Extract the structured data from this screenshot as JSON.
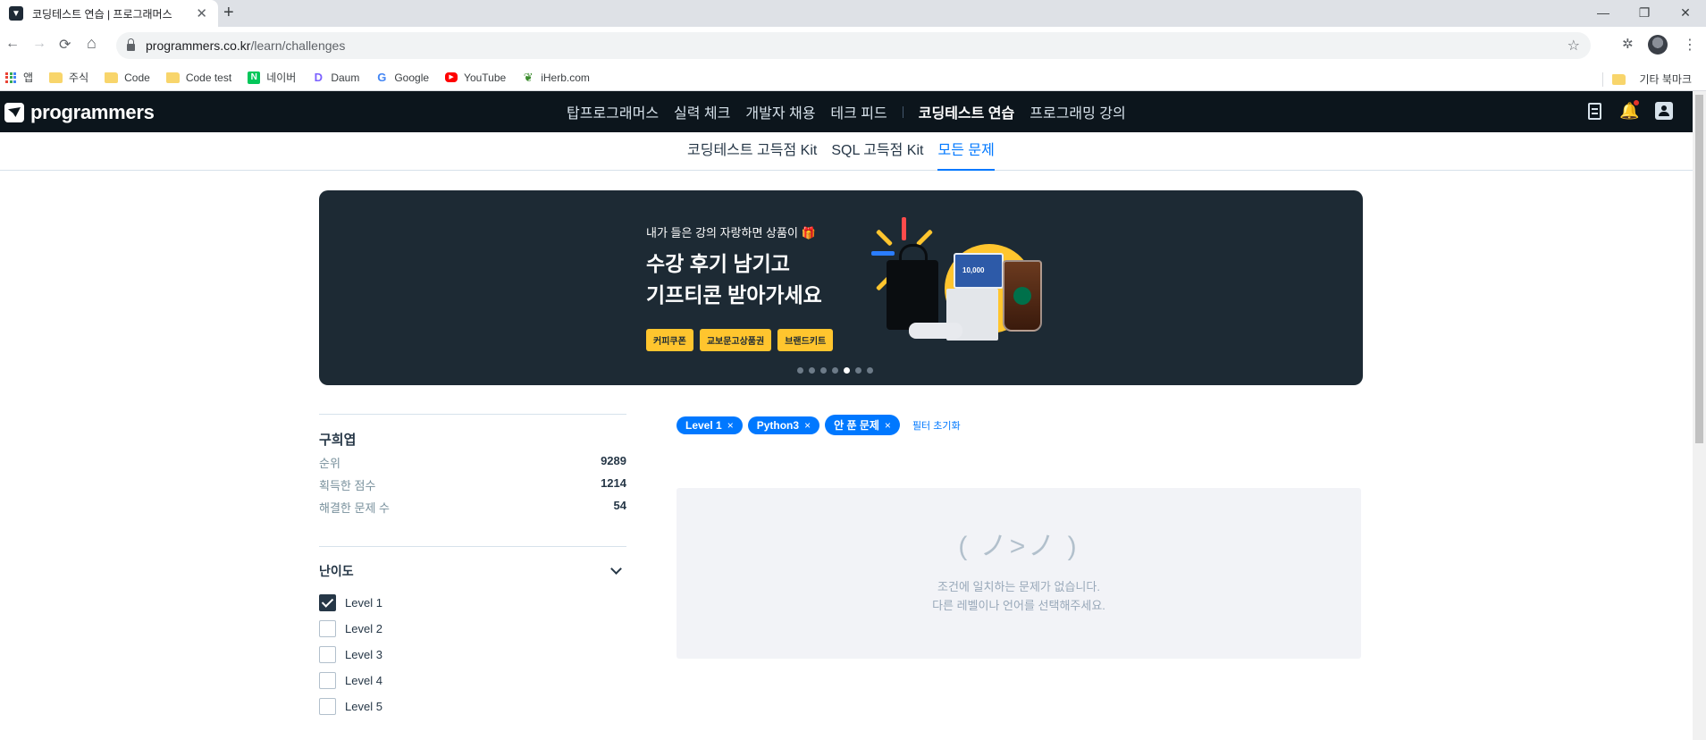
{
  "browser": {
    "tab_title": "코딩테스트 연습 | 프로그래머스",
    "tab_close": "✕",
    "new_tab": "+",
    "url_host": "programmers.co.kr",
    "url_path": "/learn/challenges",
    "win_minimize": "—",
    "win_restore": "❐",
    "win_close": "✕",
    "back": "←",
    "forward": "→",
    "reload": "⟳",
    "home": "⌂",
    "star": "☆",
    "extensions": "✲",
    "menu": "⋮",
    "bookmarks": [
      {
        "label": "앱",
        "icon": "apps-grid-icon"
      },
      {
        "label": "주식",
        "icon": "folder-icon"
      },
      {
        "label": "Code",
        "icon": "folder-icon"
      },
      {
        "label": "Code test",
        "icon": "folder-icon"
      },
      {
        "label": "네이버",
        "icon": "naver-icon",
        "glyph": "N",
        "color": "#03c75a"
      },
      {
        "label": "Daum",
        "icon": "daum-icon",
        "glyph": "D",
        "color": "#7b61ff"
      },
      {
        "label": "Google",
        "icon": "google-icon",
        "glyph": "G",
        "color": "#4285f4"
      },
      {
        "label": "YouTube",
        "icon": "youtube-icon",
        "glyph": "▶",
        "color": "#ff0000"
      },
      {
        "label": "iHerb.com",
        "icon": "iherb-icon",
        "glyph": "❦",
        "color": "#3c8d2f"
      }
    ],
    "other_bookmarks": "기타 북마크"
  },
  "gnb": {
    "logo": "programmers",
    "menu": [
      {
        "label": "탑프로그래머스",
        "active": false
      },
      {
        "label": "실력 체크",
        "active": false
      },
      {
        "label": "개발자 채용",
        "active": false
      },
      {
        "label": "테크 피드",
        "active": false
      },
      {
        "label": "코딩테스트 연습",
        "active": true
      },
      {
        "label": "프로그래밍 강의",
        "active": false
      }
    ],
    "bell": "🔔"
  },
  "subnav": [
    {
      "label": "코딩테스트 고득점 Kit",
      "active": false
    },
    {
      "label": "SQL 고득점 Kit",
      "active": false
    },
    {
      "label": "모든 문제",
      "active": true
    }
  ],
  "banner": {
    "kicker": "내가 들은 강의 자랑하면 상품이 🎁",
    "title_line1": "수강 후기 남기고",
    "title_line2": "기프티콘 받아가세요",
    "tags": [
      "커피쿠폰",
      "교보문고상품권",
      "브랜드키트"
    ],
    "card_text": "10,000",
    "dots": 7,
    "active_dot": 4
  },
  "profile": {
    "name": "구희엽",
    "stats": [
      {
        "label": "순위",
        "value": "9289"
      },
      {
        "label": "획득한 점수",
        "value": "1214"
      },
      {
        "label": "해결한 문제 수",
        "value": "54"
      }
    ]
  },
  "filter": {
    "title": "난이도",
    "levels": [
      {
        "label": "Level 1",
        "checked": true
      },
      {
        "label": "Level 2",
        "checked": false
      },
      {
        "label": "Level 3",
        "checked": false
      },
      {
        "label": "Level 4",
        "checked": false
      },
      {
        "label": "Level 5",
        "checked": false
      }
    ]
  },
  "chips": [
    {
      "label": "Level 1",
      "x": "×"
    },
    {
      "label": "Python3",
      "x": "×"
    },
    {
      "label": "안 푼 문제",
      "x": "×"
    }
  ],
  "reset_label": "필터 초기화",
  "empty": {
    "face": "( ノ>ノ )",
    "line1": "조건에 일치하는 문제가 없습니다.",
    "line2": "다른 레벨이나 언어를 선택해주세요."
  },
  "colors": {
    "accent": "#0078ff",
    "gnb_bg": "#0c151c",
    "banner_bg": "#1d2a34",
    "tag_yellow": "#ffc52e"
  }
}
